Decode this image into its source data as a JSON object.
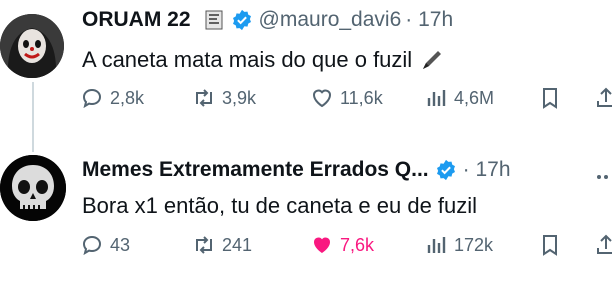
{
  "tweet1": {
    "name": "ORUAM 22",
    "handle": "@mauro_davi6",
    "time": "· 17h",
    "text": "A caneta mata mais do que o fuzil",
    "stats": {
      "replies": "2,8k",
      "retweets": "3,9k",
      "likes": "11,6k",
      "views": "4,6M"
    }
  },
  "tweet2": {
    "name": "Memes Extremamente Errados Q...",
    "time": "· 17h",
    "text": "Bora x1 então, tu de caneta e eu de fuzil",
    "stats": {
      "replies": "43",
      "retweets": "241",
      "likes": "7,6k",
      "views": "172k"
    }
  },
  "colors": {
    "verified": "#1d9bf0",
    "like_active": "#f91880",
    "muted": "#536471"
  }
}
